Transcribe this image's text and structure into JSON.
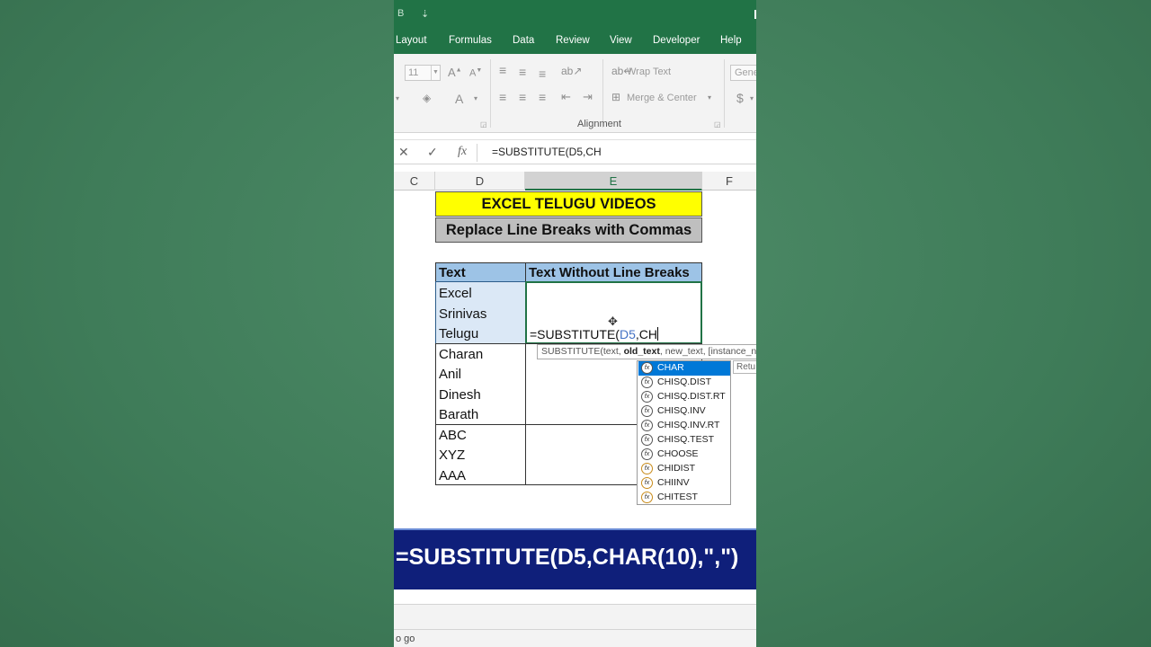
{
  "titlebar": {
    "quick_access": [
      "B",
      "⇣"
    ]
  },
  "ribbon_tabs": [
    "Layout",
    "Formulas",
    "Data",
    "Review",
    "View",
    "Developer",
    "Help"
  ],
  "ribbon": {
    "font_size": "11",
    "wrap_text": "Wrap Text",
    "merge_center": "Merge & Center",
    "number_format": "Gene",
    "alignment_group": "Alignment",
    "currency_symbol": "$"
  },
  "formula_bar": {
    "cancel": "✕",
    "enter": "✓",
    "fx": "fx",
    "content": "=SUBSTITUTE(D5,CH"
  },
  "columns": [
    "C",
    "D",
    "E",
    "F"
  ],
  "sheet": {
    "banner_title": "EXCEL TELUGU VIDEOS",
    "banner_subtitle": "Replace Line Breaks with Commas",
    "header_text": "Text",
    "header_result": "Text Without Line Breaks",
    "row1_lines": [
      "Excel",
      "Srinivas",
      "Telugu"
    ],
    "row2_lines": [
      "Charan",
      "Anil",
      "Dinesh",
      "Barath"
    ],
    "row3_lines": [
      "ABC",
      "XYZ",
      "AAA"
    ],
    "edit_prefix": "=SUBSTITUTE(",
    "edit_ref": "D5",
    "edit_suffix": ",CH"
  },
  "tooltip": {
    "prefix": "SUBSTITUTE(text, ",
    "bold": "old_text",
    "suffix": ", new_text, [instance_n"
  },
  "autocomplete": [
    {
      "label": "CHAR",
      "active": true,
      "warn": false
    },
    {
      "label": "CHISQ.DIST",
      "active": false,
      "warn": false
    },
    {
      "label": "CHISQ.DIST.RT",
      "active": false,
      "warn": false
    },
    {
      "label": "CHISQ.INV",
      "active": false,
      "warn": false
    },
    {
      "label": "CHISQ.INV.RT",
      "active": false,
      "warn": false
    },
    {
      "label": "CHISQ.TEST",
      "active": false,
      "warn": false
    },
    {
      "label": "CHOOSE",
      "active": false,
      "warn": false
    },
    {
      "label": "CHIDIST",
      "active": false,
      "warn": true
    },
    {
      "label": "CHIINV",
      "active": false,
      "warn": true
    },
    {
      "label": "CHITEST",
      "active": false,
      "warn": true
    }
  ],
  "autocomplete_side": "Retu",
  "caption": "=SUBSTITUTE(D5,CHAR(10),\",\")",
  "status": "o go",
  "colors": {
    "excel_green": "#217346",
    "banner_yellow": "#ffff00",
    "header_blue": "#9dc3e6",
    "caption_navy": "#0f1f7a",
    "selection_blue": "#0078d7"
  }
}
